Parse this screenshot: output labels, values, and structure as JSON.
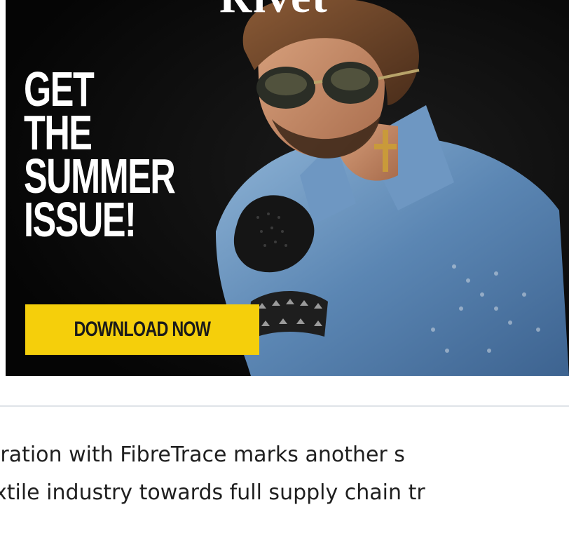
{
  "ad": {
    "masthead_fragment": "Rivet",
    "headline_lines": [
      "GET",
      "THE",
      "SUMMER",
      "ISSUE!"
    ],
    "cta_label": "DOWNLOAD NOW",
    "cta_color": "#f5cf0b",
    "background_color": "#0a0a0a"
  },
  "article": {
    "lines": [
      "oration with FibreTrace marks another s",
      "xtile industry towards full supply chain tr"
    ]
  },
  "colors": {
    "divider": "#dfe3e8",
    "body_text": "#1f1f1f"
  }
}
